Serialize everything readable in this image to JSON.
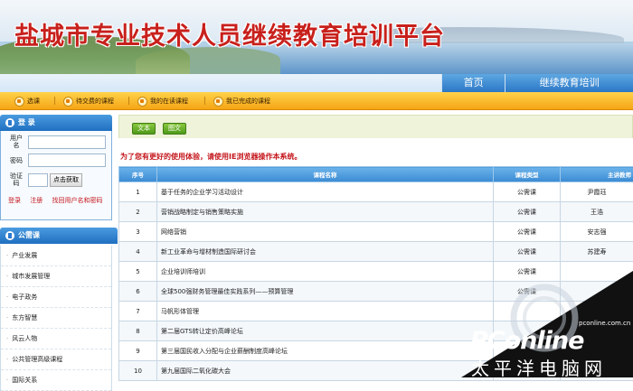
{
  "site_title": "盐城市专业技术人员继续教育培训平台",
  "top_nav": {
    "home": "首页",
    "training": "继续教育培训"
  },
  "toolbar": {
    "items": [
      "选课",
      "待交费的课程",
      "我的在读课程",
      "我已完成的课程"
    ]
  },
  "login": {
    "header": "登 录",
    "username_label": "用户名",
    "password_label": "密码",
    "captcha_label": "验证码",
    "captcha_button": "点击获取",
    "links": [
      "登录",
      "注册",
      "找回用户名和密码"
    ]
  },
  "categories": {
    "header": "公需课",
    "items": [
      "产业发展",
      "城市发展管理",
      "电子政务",
      "东方智慧",
      "风云人物",
      "公共管理高级课程",
      "国际关系"
    ]
  },
  "tabs": {
    "text": "文本",
    "image": "图文"
  },
  "notice": "为了您有更好的使用体验，请使用IE浏览器操作本系统。",
  "table": {
    "headers": [
      "序号",
      "课程名称",
      "课程类型",
      "主讲教师"
    ],
    "rows": [
      [
        "1",
        "基于任务的企业学习活动设计",
        "公需课",
        "尹霞珏"
      ],
      [
        "2",
        "营销战略制定与销售策略实施",
        "公需课",
        "王浩"
      ],
      [
        "3",
        "网络营销",
        "公需课",
        "安志强"
      ],
      [
        "4",
        "新工业革命与增材制造国际研讨会",
        "公需课",
        "苏建寿"
      ],
      [
        "5",
        "企业培训师培训",
        "公需课",
        ""
      ],
      [
        "6",
        "全球500强财务管理最佳实践系列——预算管理",
        "公需课",
        ""
      ],
      [
        "7",
        "马帆形体管理",
        "",
        ""
      ],
      [
        "8",
        "第二届GTS转让定价高峰论坛",
        "",
        ""
      ],
      [
        "9",
        "第三届国民收入分配与企业薪酬制度高峰论坛",
        "",
        ""
      ],
      [
        "10",
        "第九届国际二氧化碳大会",
        "",
        ""
      ]
    ]
  },
  "watermark": {
    "brand": "PConline",
    "sub": "太平洋电脑网",
    "url": "pconline.com.cn"
  }
}
